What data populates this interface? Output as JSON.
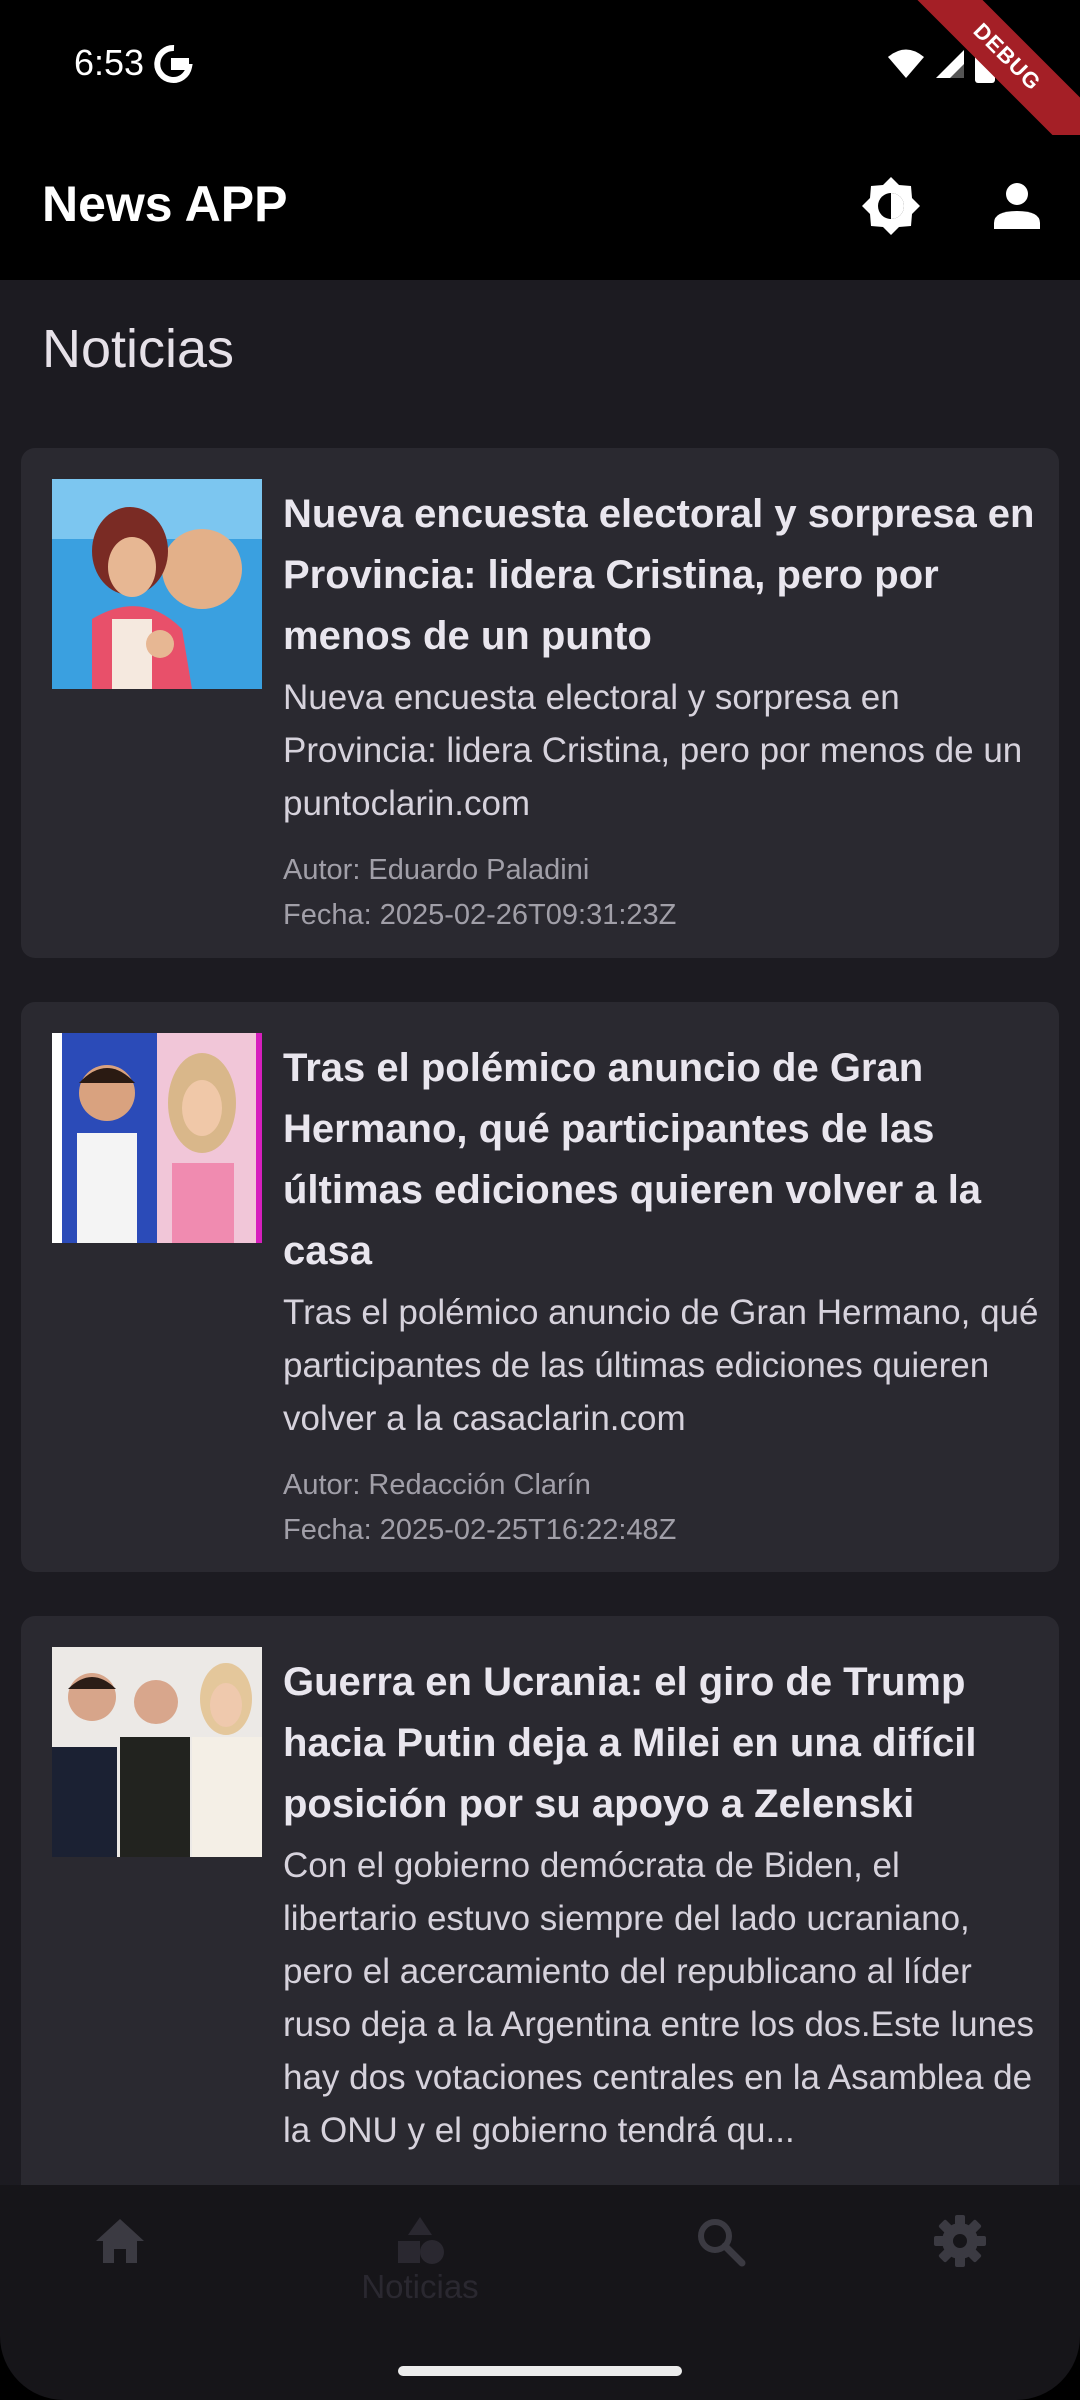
{
  "status_bar": {
    "time": "6:53",
    "debug_label": "DEBUG"
  },
  "app_bar": {
    "title": "News APP",
    "icons": [
      "brightness-icon",
      "person-icon"
    ]
  },
  "section_title": "Noticias",
  "articles": [
    {
      "title": "Nueva encuesta electoral y sorpresa en Provincia: lidera Cristina, pero por menos de un punto",
      "description": "Nueva encuesta electoral y sorpresa en Provincia: lidera Cristina, pero por menos de un puntoclarin.com",
      "author": "Autor: Eduardo Paladini",
      "date": "Fecha: 2025-02-26T09:31:23Z"
    },
    {
      "title": "Tras el polémico anuncio de Gran Hermano, qué participantes de las últimas ediciones quieren volver a la casa",
      "description": "Tras el polémico anuncio de Gran Hermano, qué participantes de las últimas ediciones quieren volver a la casaclarin.com",
      "author": "Autor: Redacción Clarín",
      "date": "Fecha: 2025-02-25T16:22:48Z"
    },
    {
      "title": "Guerra en Ucrania: el giro de Trump hacia Putin deja a Milei en una difícil posición por su apoyo a Zelenski",
      "description": "Con el gobierno demócrata de Biden, el libertario estuvo siempre del lado ucraniano, pero el acercamiento del republicano al líder ruso deja a la Argentina entre los dos.Este lunes hay dos votaciones centrales en la Asamblea de la ONU  y el gobierno tendrá qu...",
      "author": "",
      "date": ""
    }
  ],
  "bottom_nav": {
    "items": [
      {
        "icon": "home-icon",
        "label": ""
      },
      {
        "icon": "shapes-icon",
        "label": "Noticias"
      },
      {
        "icon": "search-icon",
        "label": ""
      },
      {
        "icon": "settings-icon",
        "label": ""
      }
    ]
  },
  "colors": {
    "background": "#1c1b21",
    "card": "#2a2930",
    "debug_banner": "#a41f26"
  }
}
